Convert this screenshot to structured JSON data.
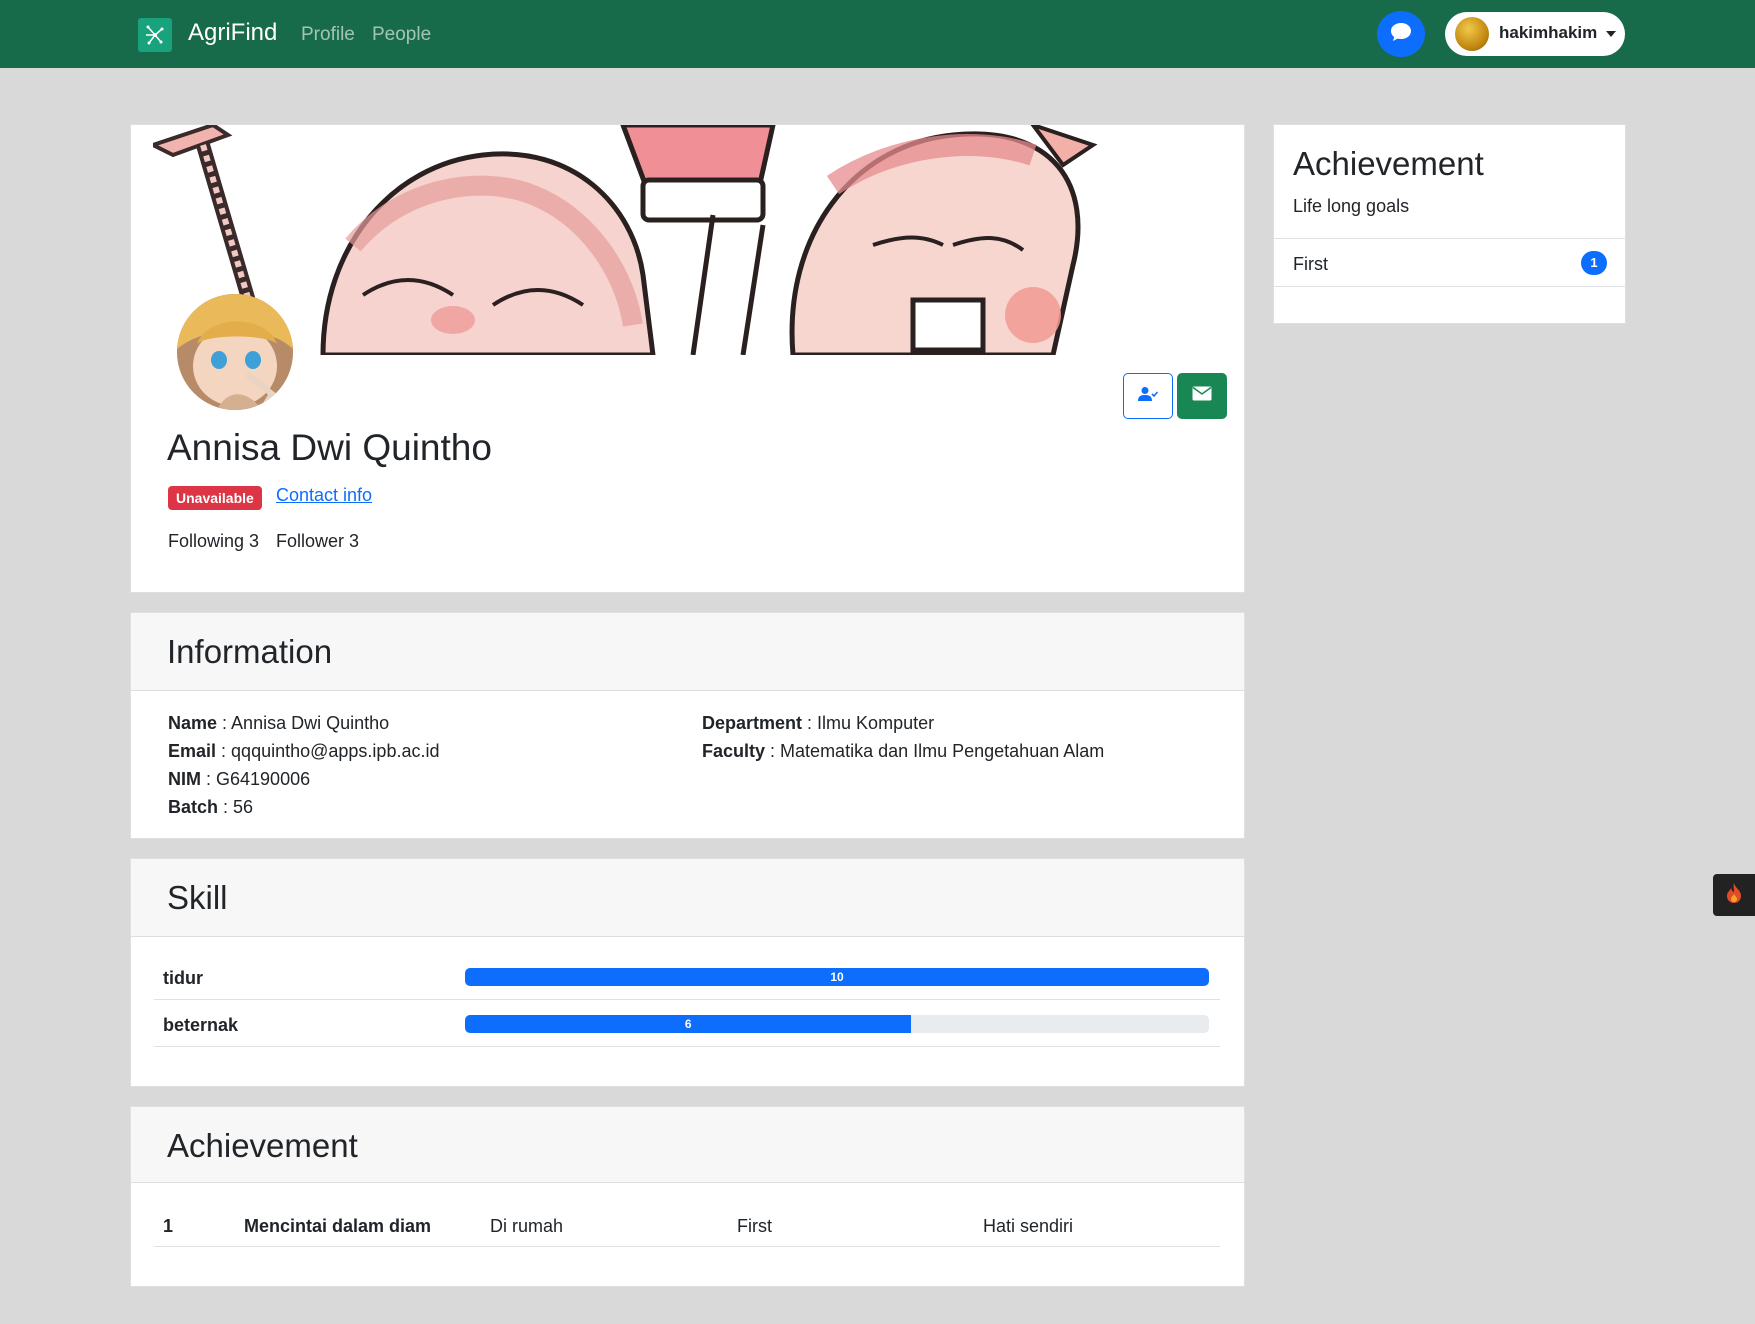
{
  "navbar": {
    "brand": "AgriFind",
    "links": [
      "Profile",
      "People"
    ],
    "username": "hakimhakim"
  },
  "profile": {
    "name": "Annisa Dwi Quintho",
    "status": "Unavailable",
    "contact_link": "Contact info",
    "following": "Following 3",
    "follower": "Follower 3"
  },
  "information": {
    "title": "Information",
    "fields": [
      {
        "label": "Name",
        "value": "Annisa Dwi Quintho"
      },
      {
        "label": "Email",
        "value": "qqquintho@apps.ipb.ac.id"
      },
      {
        "label": "NIM",
        "value": "G64190006"
      },
      {
        "label": "Batch",
        "value": "56"
      },
      {
        "label": "Department",
        "value": "Ilmu Komputer"
      },
      {
        "label": "Faculty",
        "value": "Matematika dan Ilmu Pengetahuan Alam"
      }
    ]
  },
  "skill": {
    "title": "Skill",
    "items": [
      {
        "name": "tidur",
        "level": 10,
        "max": 10
      },
      {
        "name": "beternak",
        "level": 6,
        "max": 10
      }
    ]
  },
  "achievement_table": {
    "title": "Achievement",
    "rows": [
      {
        "no": "1",
        "title": "Mencintai dalam diam",
        "place": "Di rumah",
        "rank": "First",
        "issuer": "Hati sendiri"
      }
    ]
  },
  "side_achievement": {
    "title": "Achievement",
    "subtitle": "Life long goals",
    "items": [
      {
        "label": "First",
        "count": "1"
      }
    ]
  },
  "colors": {
    "navbar": "#186b4a",
    "primary": "#0d6efd",
    "success": "#198754",
    "danger": "#dc3545"
  },
  "icons": [
    "agrifind-logo-icon",
    "chat-bubble-icon",
    "user-check-icon",
    "envelope-icon",
    "fire-icon"
  ]
}
